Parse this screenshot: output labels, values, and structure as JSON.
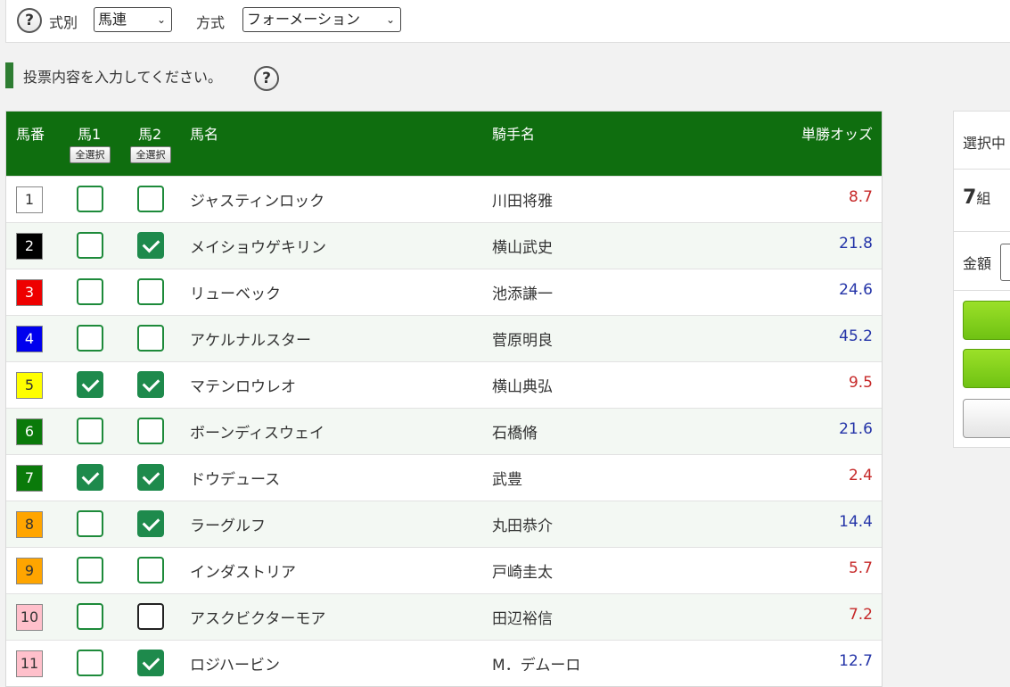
{
  "top": {
    "help_icon": "question-mark",
    "shiki_label": "式別",
    "shiki_value": "馬連",
    "hoshiki_label": "方式",
    "hoshiki_value": "フォーメーション"
  },
  "notice": {
    "text": "投票内容を入力してください。",
    "help_icon": "question-mark"
  },
  "table": {
    "headers": {
      "num": "馬番",
      "horse1": "馬1",
      "horse2": "馬2",
      "name": "馬名",
      "jockey": "騎手名",
      "odds": "単勝オッズ"
    },
    "select_all_label": "全選択",
    "rows": [
      {
        "num": "1",
        "num_bg": "#ffffff",
        "num_fg": "#333333",
        "h1": false,
        "h2": false,
        "name": "ジャスティンロック",
        "jockey": "川田将雅",
        "odds": "8.7",
        "odds_color": "red"
      },
      {
        "num": "2",
        "num_bg": "#000000",
        "num_fg": "#ffffff",
        "h1": false,
        "h2": true,
        "name": "メイショウゲキリン",
        "jockey": "横山武史",
        "odds": "21.8",
        "odds_color": "blue"
      },
      {
        "num": "3",
        "num_bg": "#ee0000",
        "num_fg": "#ffffff",
        "h1": false,
        "h2": false,
        "name": "リューベック",
        "jockey": "池添謙一",
        "odds": "24.6",
        "odds_color": "blue"
      },
      {
        "num": "4",
        "num_bg": "#0000ee",
        "num_fg": "#ffffff",
        "h1": false,
        "h2": false,
        "name": "アケルナルスター",
        "jockey": "菅原明良",
        "odds": "45.2",
        "odds_color": "blue"
      },
      {
        "num": "5",
        "num_bg": "#ffff00",
        "num_fg": "#333333",
        "h1": true,
        "h2": true,
        "name": "マテンロウレオ",
        "jockey": "横山典弘",
        "odds": "9.5",
        "odds_color": "red"
      },
      {
        "num": "6",
        "num_bg": "#0a7a0a",
        "num_fg": "#ffffff",
        "h1": false,
        "h2": false,
        "name": "ボーンディスウェイ",
        "jockey": "石橋脩",
        "odds": "21.6",
        "odds_color": "blue"
      },
      {
        "num": "7",
        "num_bg": "#0a7a0a",
        "num_fg": "#ffffff",
        "h1": true,
        "h2": true,
        "name": "ドウデュース",
        "jockey": "武豊",
        "odds": "2.4",
        "odds_color": "red"
      },
      {
        "num": "8",
        "num_bg": "#ffa500",
        "num_fg": "#333333",
        "h1": false,
        "h2": true,
        "name": "ラーグルフ",
        "jockey": "丸田恭介",
        "odds": "14.4",
        "odds_color": "blue"
      },
      {
        "num": "9",
        "num_bg": "#ffa500",
        "num_fg": "#333333",
        "h1": false,
        "h2": false,
        "name": "インダストリア",
        "jockey": "戸崎圭太",
        "odds": "5.7",
        "odds_color": "red"
      },
      {
        "num": "10",
        "num_bg": "#ffc0cb",
        "num_fg": "#333333",
        "h1": false,
        "h2": false,
        "h2_dark": true,
        "name": "アスクビクターモア",
        "jockey": "田辺裕信",
        "odds": "7.2",
        "odds_color": "red"
      },
      {
        "num": "11",
        "num_bg": "#ffc0cb",
        "num_fg": "#333333",
        "h1": false,
        "h2": true,
        "name": "ロジハービン",
        "jockey": "M．デムーロ",
        "odds": "12.7",
        "odds_color": "blue"
      }
    ]
  },
  "side": {
    "selected_label": "選択中",
    "count_num": "7",
    "count_unit": "組",
    "amount_label": "金額"
  }
}
